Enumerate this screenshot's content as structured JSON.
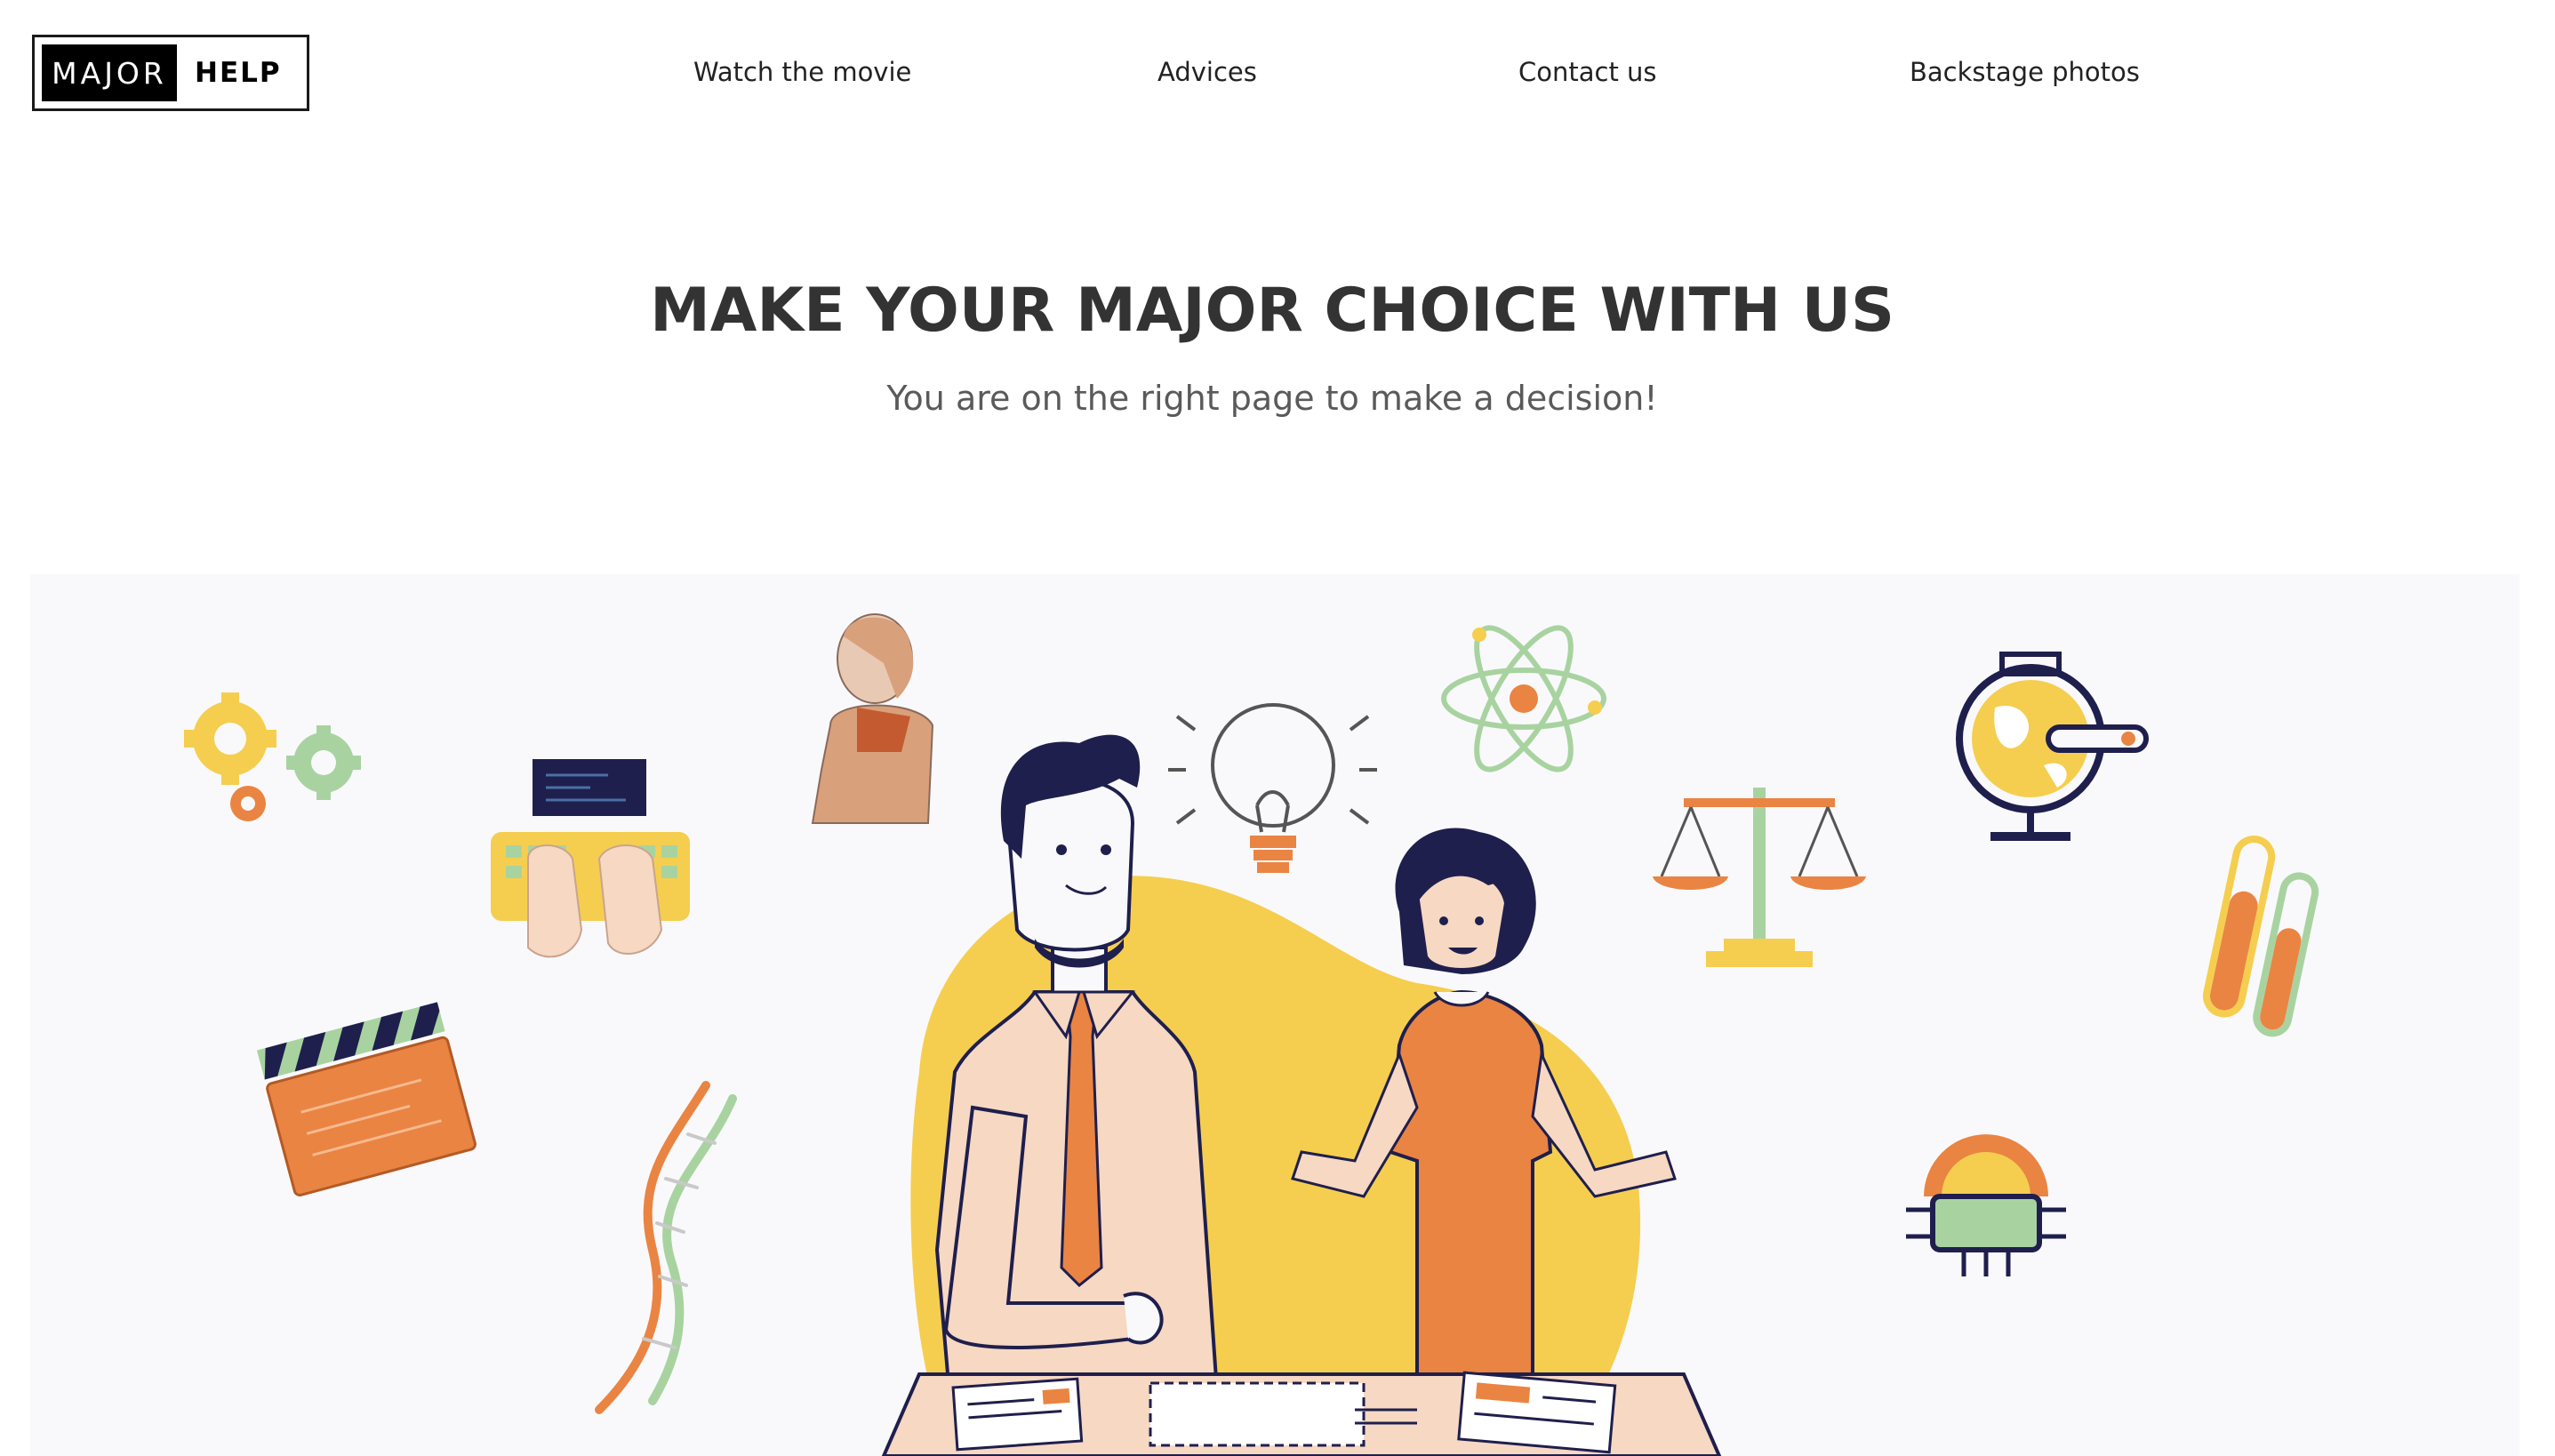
{
  "logo": {
    "major": "MAJOR",
    "help": "HELP"
  },
  "nav": {
    "items": [
      {
        "label": "Watch the movie"
      },
      {
        "label": "Advices"
      },
      {
        "label": "Contact us"
      },
      {
        "label": "Backstage photos"
      }
    ]
  },
  "hero": {
    "title": "MAKE YOUR MAJOR CHOICE WITH US",
    "subtitle": "You are on the right page to make a decision!"
  },
  "colors": {
    "yellow": "#f5ce4f",
    "orange": "#ea8442",
    "navy": "#1f1f4d",
    "skin": "#f6d8c3",
    "green": "#a8d3a0",
    "background": "#f9f9fc"
  }
}
